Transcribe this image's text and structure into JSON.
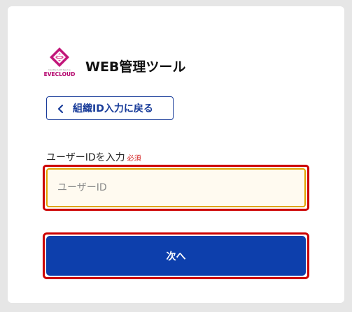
{
  "header": {
    "logo_subtext": "Identity Auth Service",
    "logo_name": "EVECLOUD",
    "title": "WEB管理ツール"
  },
  "back_button": {
    "label": "組織ID入力に戻る",
    "icon": "chevron-left-icon"
  },
  "user_id_field": {
    "label": "ユーザーIDを入力",
    "required_badge": "必須",
    "placeholder": "ユーザーID",
    "value": ""
  },
  "submit_button": {
    "label": "次へ"
  },
  "colors": {
    "primary": "#0d3fac",
    "back_border": "#1a3d9a",
    "required": "#d32020",
    "highlight": "#cc0000",
    "focus": "#e0a400",
    "brand": "#b3006b"
  }
}
